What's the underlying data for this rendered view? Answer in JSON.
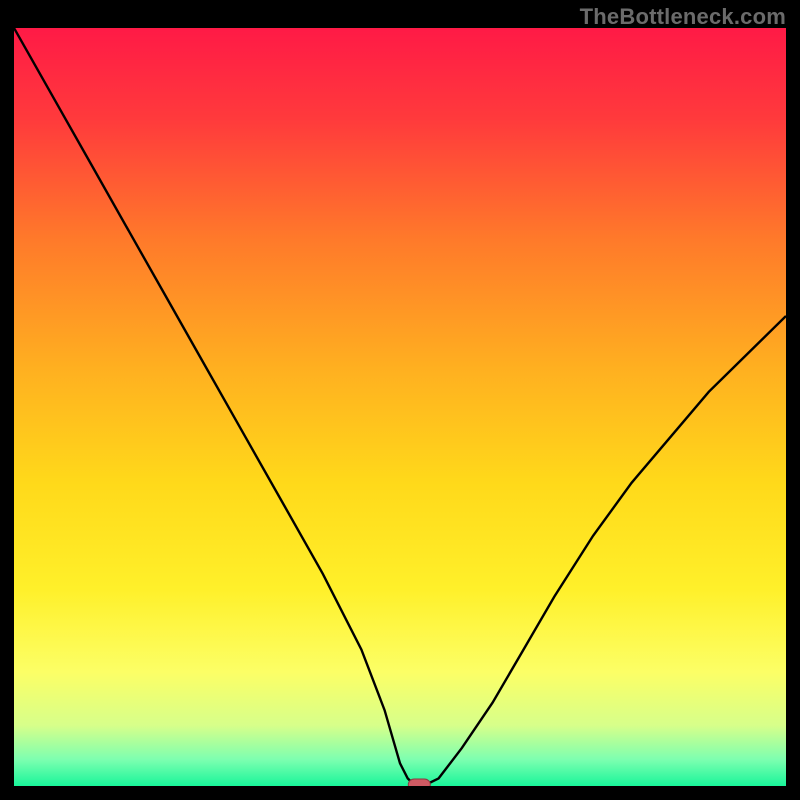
{
  "watermark": {
    "text": "TheBottleneck.com"
  },
  "colors": {
    "bg": "#000000",
    "gradient_stops": [
      {
        "offset": 0.0,
        "color": "#ff1a46"
      },
      {
        "offset": 0.12,
        "color": "#ff3a3c"
      },
      {
        "offset": 0.28,
        "color": "#ff7a2a"
      },
      {
        "offset": 0.45,
        "color": "#ffb020"
      },
      {
        "offset": 0.6,
        "color": "#ffd91a"
      },
      {
        "offset": 0.74,
        "color": "#fff02a"
      },
      {
        "offset": 0.85,
        "color": "#fcff66"
      },
      {
        "offset": 0.92,
        "color": "#d7ff8a"
      },
      {
        "offset": 0.965,
        "color": "#7dffb0"
      },
      {
        "offset": 1.0,
        "color": "#19f59a"
      }
    ],
    "curve": "#000000",
    "marker_fill": "#cf5a63",
    "marker_stroke": "#8c3a42"
  },
  "chart_data": {
    "type": "line",
    "title": "",
    "xlabel": "",
    "ylabel": "",
    "xlim": [
      0,
      100
    ],
    "ylim": [
      0,
      100
    ],
    "grid": false,
    "legend": false,
    "series": [
      {
        "name": "bottleneck-curve",
        "x": [
          0,
          5,
          10,
          15,
          20,
          25,
          30,
          35,
          40,
          45,
          48,
          50,
          51,
          52,
          53,
          55,
          58,
          62,
          66,
          70,
          75,
          80,
          85,
          90,
          95,
          100
        ],
        "y": [
          100,
          91,
          82,
          73,
          64,
          55,
          46,
          37,
          28,
          18,
          10,
          3,
          1,
          0,
          0,
          1,
          5,
          11,
          18,
          25,
          33,
          40,
          46,
          52,
          57,
          62
        ]
      }
    ],
    "marker": {
      "x": 52.5,
      "y": 0
    },
    "annotations": []
  }
}
